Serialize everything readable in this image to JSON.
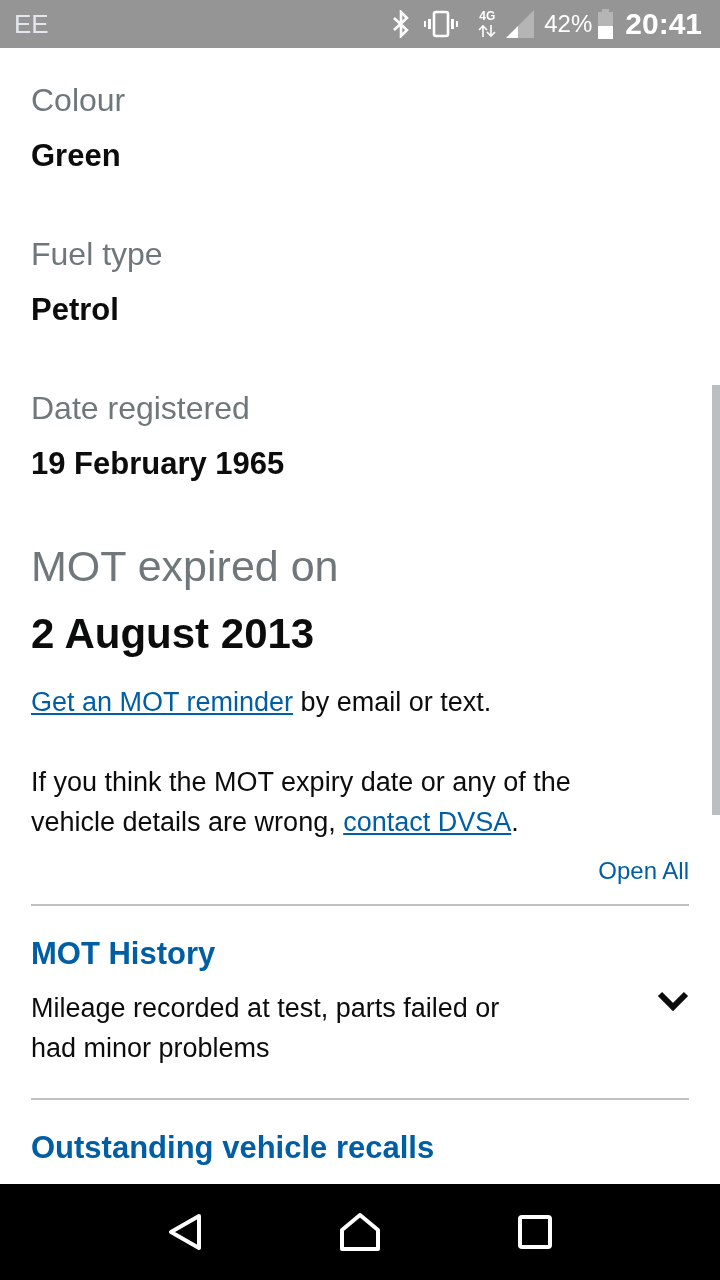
{
  "status_bar": {
    "carrier": "EE",
    "network": "4G",
    "battery": "42%",
    "time": "20:41"
  },
  "details": [
    {
      "label": "Colour",
      "value": "Green"
    },
    {
      "label": "Fuel type",
      "value": "Petrol"
    },
    {
      "label": "Date registered",
      "value": "19 February 1965"
    }
  ],
  "mot": {
    "label": "MOT expired on",
    "date": "2 August 2013"
  },
  "reminder": {
    "link": "Get an MOT reminder",
    "text": "by email or text."
  },
  "notice": {
    "text": "If you think the MOT expiry date or any of the vehicle details are wrong,",
    "link": "contact DVSA",
    "end": "."
  },
  "open_all": "Open All",
  "accordion": [
    {
      "title": "MOT History",
      "description": "Mileage recorded at test, parts failed or had minor problems",
      "expanded": false
    },
    {
      "title": "Outstanding vehicle recalls"
    }
  ]
}
